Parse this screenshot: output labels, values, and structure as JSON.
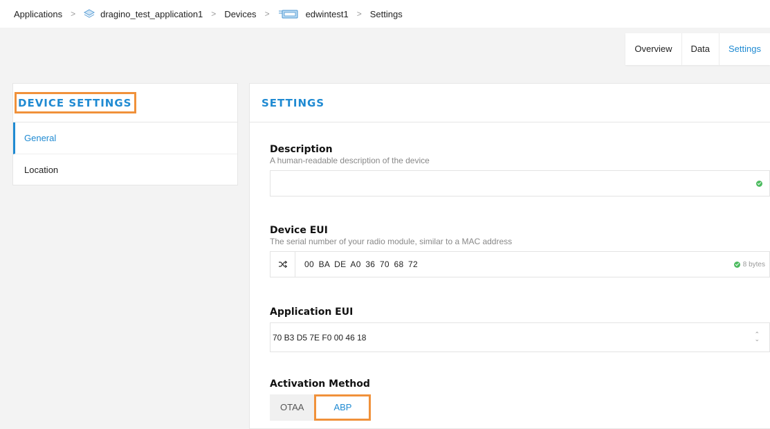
{
  "breadcrumb": {
    "applications": "Applications",
    "application_name": "dragino_test_application1",
    "devices": "Devices",
    "device_name": "edwintest1",
    "current": "Settings",
    "separator": ">"
  },
  "tabs": [
    {
      "label": "Overview"
    },
    {
      "label": "Data"
    },
    {
      "label": "Settings"
    }
  ],
  "sidebar": {
    "title": "DEVICE SETTINGS",
    "items": [
      {
        "label": "General"
      },
      {
        "label": "Location"
      }
    ]
  },
  "settings": {
    "title": "SETTINGS",
    "description": {
      "label": "Description",
      "help": "A human-readable description of the device",
      "value": ""
    },
    "device_eui": {
      "label": "Device EUI",
      "help": "The serial number of your radio module, similar to a MAC address",
      "value": "00 BA DE A0 36 70 68 72",
      "bytes_label": "8 bytes"
    },
    "app_eui": {
      "label": "Application EUI",
      "value": "70 B3 D5 7E F0 00 46 18"
    },
    "activation": {
      "label": "Activation Method",
      "options": [
        "OTAA",
        "ABP"
      ],
      "selected": "ABP"
    }
  },
  "colors": {
    "accent": "#1f8ad2",
    "highlight": "#f0913a",
    "ok": "#4cbb5f"
  }
}
